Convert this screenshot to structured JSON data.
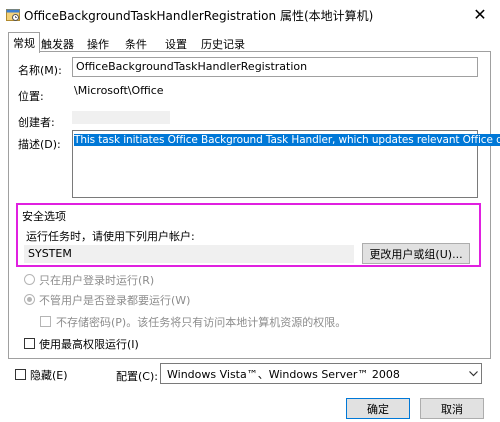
{
  "window": {
    "title": "OfficeBackgroundTaskHandlerRegistration 属性(本地计算机)",
    "close_glyph": "✕"
  },
  "tabs": [
    {
      "label": "常规",
      "active": true
    },
    {
      "label": "触发器",
      "active": false
    },
    {
      "label": "操作",
      "active": false
    },
    {
      "label": "条件",
      "active": false
    },
    {
      "label": "设置",
      "active": false
    },
    {
      "label": "历史记录",
      "active": false
    }
  ],
  "general": {
    "name_label": "名称(M):",
    "name_value": "OfficeBackgroundTaskHandlerRegistration",
    "location_label": "位置:",
    "location_value": "\\Microsoft\\Office",
    "author_label": "创建者:",
    "author_value": "",
    "description_label": "描述(D):",
    "description_value": "This task initiates Office Background Task Handler, which updates relevant Office data."
  },
  "security": {
    "group_label": "安全选项",
    "run_as_label": "运行任务时，请使用下列用户帐户:",
    "user_account": "SYSTEM",
    "change_user_button": "更改用户或组(U)...",
    "highlight_color": "#e020e0",
    "radio_logged_on": "只在用户登录时运行(R)",
    "radio_whether_logged_on": "不管用户是否登录都要运行(W)",
    "checkbox_no_store_password": "不存储密码(P)。该任务将只有访问本地计算机资源的权限。",
    "checkbox_highest_privileges": "使用最高权限运行(I)"
  },
  "footer": {
    "hidden_label": "隐藏(E)",
    "configure_label": "配置(C):",
    "configure_value": "Windows Vista™、Windows Server™ 2008",
    "ok_button": "确定",
    "cancel_button": "取消"
  },
  "colors": {
    "selection_bg": "#0078d7",
    "selection_fg": "#ffffff"
  }
}
